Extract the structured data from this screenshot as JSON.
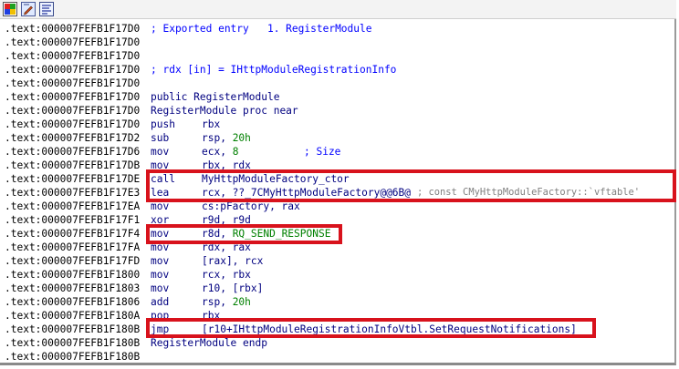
{
  "toolbar": {
    "buttons": [
      {
        "icon": "color-palette-icon"
      },
      {
        "icon": "edit-icon"
      },
      {
        "icon": "graph-icon"
      }
    ]
  },
  "listing": {
    "lines": [
      {
        "addr": ".text:000007FEFB1F17D0",
        "kind": "comment",
        "text": "; Exported entry   1. RegisterModule"
      },
      {
        "addr": ".text:000007FEFB1F17D0",
        "kind": "blank"
      },
      {
        "addr": ".text:000007FEFB1F17D0",
        "kind": "blank"
      },
      {
        "addr": ".text:000007FEFB1F17D0",
        "kind": "comment",
        "text": "; rdx [in] = IHttpModuleRegistrationInfo"
      },
      {
        "addr": ".text:000007FEFB1F17D0",
        "kind": "blank"
      },
      {
        "addr": ".text:000007FEFB1F17D0",
        "kind": "directive",
        "text": "public RegisterModule"
      },
      {
        "addr": ".text:000007FEFB1F17D0",
        "kind": "directive",
        "text": "RegisterModule proc near"
      },
      {
        "addr": ".text:000007FEFB1F17D0",
        "kind": "insn",
        "mnem": "push",
        "ops": "rbx"
      },
      {
        "addr": ".text:000007FEFB1F17D2",
        "kind": "insn",
        "mnem": "sub",
        "ops": "rsp, 20h"
      },
      {
        "addr": ".text:000007FEFB1F17D6",
        "kind": "insn",
        "mnem": "mov",
        "ops": "ecx, 8",
        "tail": "; Size"
      },
      {
        "addr": ".text:000007FEFB1F17DB",
        "kind": "insn",
        "mnem": "mov",
        "ops": "rbx, rdx"
      },
      {
        "addr": ".text:000007FEFB1F17DE",
        "kind": "insn",
        "mnem": "call",
        "ops": "MyHttpModuleFactory_ctor"
      },
      {
        "addr": ".text:000007FEFB1F17E3",
        "kind": "insn",
        "mnem": "lea",
        "ops": "rcx, ??_7CMyHttpModuleFactory@@6B@",
        "tail": "; const CMyHttpModuleFactory::`vftable'"
      },
      {
        "addr": ".text:000007FEFB1F17EA",
        "kind": "insn",
        "mnem": "mov",
        "ops": "cs:pFactory, rax"
      },
      {
        "addr": ".text:000007FEFB1F17F1",
        "kind": "insn",
        "mnem": "xor",
        "ops": "r9d, r9d"
      },
      {
        "addr": ".text:000007FEFB1F17F4",
        "kind": "insn",
        "mnem": "mov",
        "ops": "r8d, RQ_SEND_RESPONSE"
      },
      {
        "addr": ".text:000007FEFB1F17FA",
        "kind": "insn",
        "mnem": "mov",
        "ops": "rdx, rax"
      },
      {
        "addr": ".text:000007FEFB1F17FD",
        "kind": "insn",
        "mnem": "mov",
        "ops": "[rax], rcx"
      },
      {
        "addr": ".text:000007FEFB1F1800",
        "kind": "insn",
        "mnem": "mov",
        "ops": "rcx, rbx"
      },
      {
        "addr": ".text:000007FEFB1F1803",
        "kind": "insn",
        "mnem": "mov",
        "ops": "r10, [rbx]"
      },
      {
        "addr": ".text:000007FEFB1F1806",
        "kind": "insn",
        "mnem": "add",
        "ops": "rsp, 20h"
      },
      {
        "addr": ".text:000007FEFB1F180A",
        "kind": "insn",
        "mnem": "pop",
        "ops": "rbx"
      },
      {
        "addr": ".text:000007FEFB1F180B",
        "kind": "insn",
        "mnem": "jmp",
        "ops": "[r10+IHttpModuleRegistrationInfoVtbl.SetRequestNotifications]"
      },
      {
        "addr": ".text:000007FEFB1F180B",
        "kind": "directive",
        "text": "RegisterModule endp"
      },
      {
        "addr": ".text:000007FEFB1F180B",
        "kind": "blank"
      }
    ]
  },
  "colors": {
    "highlight_box": "#d8121c",
    "mnemonic": "#000080",
    "comment": "#0000ff",
    "number": "#008000",
    "address": "#000000"
  }
}
